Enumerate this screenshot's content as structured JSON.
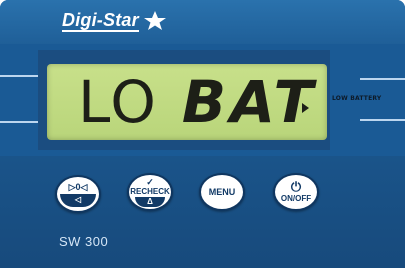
{
  "brand": {
    "name": "Digi-Star"
  },
  "display": {
    "left_text": "LO",
    "right_text": "BAT",
    "indicator_label": "LOW BATTERY"
  },
  "buttons": {
    "zero": {
      "top": "▷0◁",
      "sub": "◁"
    },
    "recheck": {
      "top": "✓",
      "label": "RECHECK",
      "sub": "Δ"
    },
    "menu": {
      "label": "MENU"
    },
    "onoff": {
      "top": "⏻",
      "label": "ON/OFF"
    }
  },
  "model": {
    "text": "SW 300"
  },
  "colors": {
    "panel": "#1f5f98",
    "lcd": "#c8e08a",
    "button": "#ffffff",
    "button_text": "#123a66"
  }
}
